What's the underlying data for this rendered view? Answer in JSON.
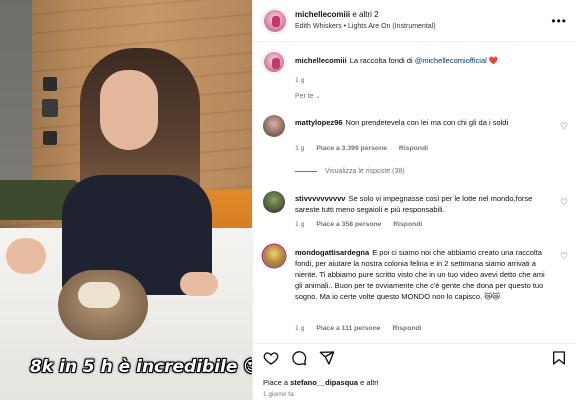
{
  "post": {
    "caption_overlay": "8k in 5 h è incredibile",
    "caption_emoji": "😍"
  },
  "header": {
    "username": "michellecomiii",
    "coauthors": "e altri 2",
    "song": "Edith Whiskers • Lights Are On (Instrumental)"
  },
  "original_post": {
    "username": "michellecomiii",
    "text": "La raccolta fondi di ",
    "mention": "@michellecomiofficial",
    "heart": "❤️",
    "time": "1 g"
  },
  "per_te": "Per te",
  "comments": [
    {
      "username": "mattylopez96",
      "text": "Non prendetevela con lei ma con chi gli da i soldi",
      "time": "1 g",
      "likes": "Piace a 3.399 persone",
      "reply": "Rispondi",
      "see_replies": "Visualizza le risposte (38)"
    },
    {
      "username": "stivvvvvvvvvv",
      "text": "Se solo vi impegnasse così per le lotte nel mondo,forse sareste tutti meno segaioli e più responsabili.",
      "time": "1 g",
      "likes": "Piace a 358 persone",
      "reply": "Rispondi"
    },
    {
      "username": "mondogattisardegna",
      "text": "E poi ci siamo noi che abbiamo creato una raccolta fondi, per aiutare la nostra colonia felina e in 2 settimana siamo arrivati a niente. Ti abbiamo pure scritto visto che in un tuo video avevi detto che ami gli animali.. Buon per te ovviamente che c'è gente che dona per questo tuo sogno. Ma io certe volte questo MONDO non lo capisco. 😿😿",
      "time": "1 g",
      "likes": "Piace a 111 persone",
      "reply": "Rispondi"
    }
  ],
  "footer": {
    "likes_prefix": "Piace a ",
    "likes_user": "stefano__dipasqua",
    "likes_suffix": " e altri",
    "ago": "1 giorno fa"
  },
  "icons": [
    "heart-icon",
    "comment-icon",
    "share-icon",
    "bookmark-icon",
    "more-icon",
    "chevron-down-icon"
  ],
  "colors": {
    "heart_red": "#ed4956",
    "link_blue": "#00376b",
    "meta_gray": "#737373"
  }
}
